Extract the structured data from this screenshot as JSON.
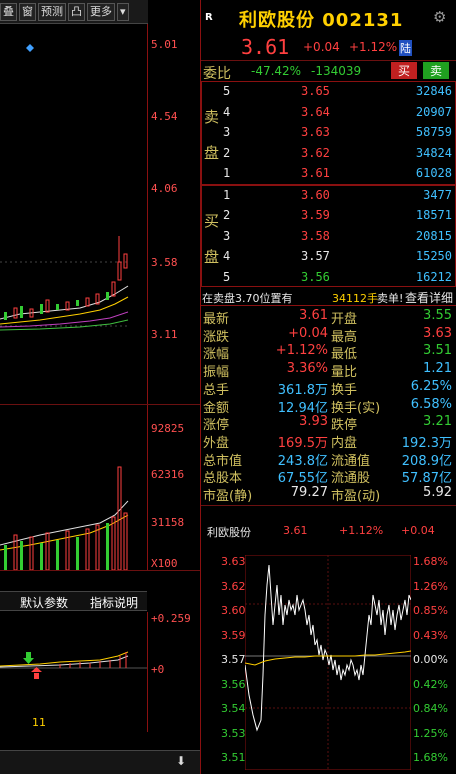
{
  "toolbar": {
    "items": [
      "叠",
      "窗",
      "预测",
      "凸",
      "更多"
    ]
  },
  "price_scale": [
    "5.01",
    "4.54",
    "4.06",
    "3.58",
    "3.11"
  ],
  "volume_scale": [
    "92825",
    "62316",
    "31158",
    "X100"
  ],
  "indicator": {
    "tab_default": "默认参数",
    "tab_help": "指标说明",
    "scale_top": "+0.259",
    "scale_zero": "+0",
    "date_label": "11"
  },
  "header": {
    "r_badge": "R",
    "name_code": "利欧股份 002131",
    "price": "3.61",
    "change": "+0.04",
    "change_pct": "+1.12%",
    "board_badge": "陆"
  },
  "weibi": {
    "label": "委比",
    "ratio": "-47.42%",
    "diff": "-134039",
    "sell_btn": "买",
    "buy_btn": "卖"
  },
  "sell_side": {
    "labels": [
      "卖",
      "盘"
    ],
    "rows": [
      {
        "level": "5",
        "price": "3.65",
        "vol": "32846"
      },
      {
        "level": "4",
        "price": "3.64",
        "vol": "20907"
      },
      {
        "level": "3",
        "price": "3.63",
        "vol": "58759"
      },
      {
        "level": "2",
        "price": "3.62",
        "vol": "34824"
      },
      {
        "level": "1",
        "price": "3.61",
        "vol": "61028"
      }
    ]
  },
  "buy_side": {
    "labels": [
      "买",
      "盘"
    ],
    "rows": [
      {
        "level": "1",
        "price": "3.60",
        "vol": "3477"
      },
      {
        "level": "2",
        "price": "3.59",
        "vol": "18571"
      },
      {
        "level": "3",
        "price": "3.58",
        "vol": "20815"
      },
      {
        "level": "4",
        "price": "3.57",
        "vol": "15250"
      },
      {
        "level": "5",
        "price": "3.56",
        "vol": "16212"
      }
    ]
  },
  "notice": {
    "prefix": "在卖盘3.70位置有",
    "amount": "34112手",
    "suffix": "卖单!",
    "link": "查看详细"
  },
  "stats": [
    {
      "l1": "最新",
      "v1": "3.61",
      "l2": "开盘",
      "v2": "3.55"
    },
    {
      "l1": "涨跌",
      "v1": "+0.04",
      "l2": "最高",
      "v2": "3.63"
    },
    {
      "l1": "涨幅",
      "v1": "+1.12%",
      "l2": "最低",
      "v2": "3.51"
    },
    {
      "l1": "振幅",
      "v1": "3.36%",
      "l2": "量比",
      "v2": "1.21"
    },
    {
      "l1": "总手",
      "v1": "361.8万",
      "l2": "换手",
      "v2": "6.25%"
    },
    {
      "l1": "金额",
      "v1": "12.94亿",
      "l2": "换手(实)",
      "v2": "6.58%"
    },
    {
      "l1": "涨停",
      "v1": "3.93",
      "l2": "跌停",
      "v2": "3.21"
    },
    {
      "l1": "外盘",
      "v1": "169.5万",
      "l2": "内盘",
      "v2": "192.3万"
    },
    {
      "l1": "总市值",
      "v1": "243.8亿",
      "l2": "流通值",
      "v2": "208.9亿"
    },
    {
      "l1": "总股本",
      "v1": "67.55亿",
      "l2": "流通股",
      "v2": "57.87亿"
    },
    {
      "l1": "市盈(静)",
      "v1": "79.27",
      "l2": "市盈(动)",
      "v2": "5.92"
    }
  ],
  "mini_chart": {
    "name": "利欧股份",
    "price": "3.61",
    "pct": "+1.12%",
    "chg": "+0.04",
    "left_scale": [
      "3.63",
      "3.62",
      "3.60",
      "3.59",
      "3.57",
      "3.56",
      "3.54",
      "3.53",
      "3.51"
    ],
    "right_scale": [
      "1.68%",
      "1.26%",
      "0.85%",
      "0.43%",
      "0.00%",
      "0.42%",
      "0.84%",
      "1.25%",
      "1.68%"
    ]
  },
  "colors": {
    "up": "#ff4040",
    "down": "#33cc33",
    "grid": "#8a1010",
    "label": "#d0c060"
  }
}
